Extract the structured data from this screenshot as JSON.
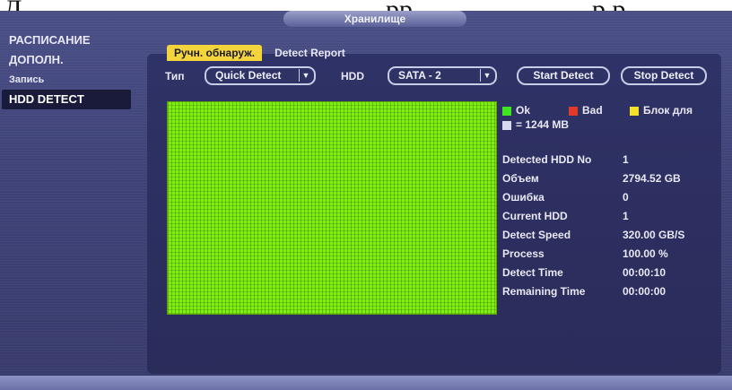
{
  "caption": {
    "left": "Д",
    "middle": "рр",
    "right": "р   р"
  },
  "window": {
    "title": "Хранилище"
  },
  "sidebar": {
    "items": [
      {
        "label": "РАСПИСАНИЕ"
      },
      {
        "label": "ДОПОЛН."
      },
      {
        "label": "Запись"
      },
      {
        "label": "HDD DETECT"
      }
    ],
    "active_index": 3
  },
  "tabs": [
    {
      "label": "Ручн. обнаруж.",
      "active": true
    },
    {
      "label": "Detect Report",
      "active": false
    }
  ],
  "controls": {
    "type_label": "Тип",
    "type_value": "Quick Detect",
    "hdd_label": "HDD",
    "hdd_value": "SATA - 2",
    "start_button": "Start Detect",
    "stop_button": "Stop Detect"
  },
  "legend": {
    "ok": "Ok",
    "bad": "Bad",
    "block": "Блок для",
    "unit": "= 1244 MB",
    "colors": {
      "ok": "#3fe620",
      "bad": "#e23a2a",
      "block": "#f3e12a",
      "unit": "#d8d8ee"
    }
  },
  "info": [
    {
      "key": "Detected HDD No",
      "value": "1"
    },
    {
      "key": "Объем",
      "value": "2794.52 GB"
    },
    {
      "key": "Ошибка",
      "value": "0"
    },
    {
      "key": "Current HDD",
      "value": "1"
    },
    {
      "key": "Detect Speed",
      "value": "320.00 GB/S"
    },
    {
      "key": "Process",
      "value": "100.00 %"
    },
    {
      "key": "Detect Time",
      "value": "00:00:10"
    },
    {
      "key": "Remaining Time",
      "value": "00:00:00"
    }
  ],
  "grid_status": "ok"
}
